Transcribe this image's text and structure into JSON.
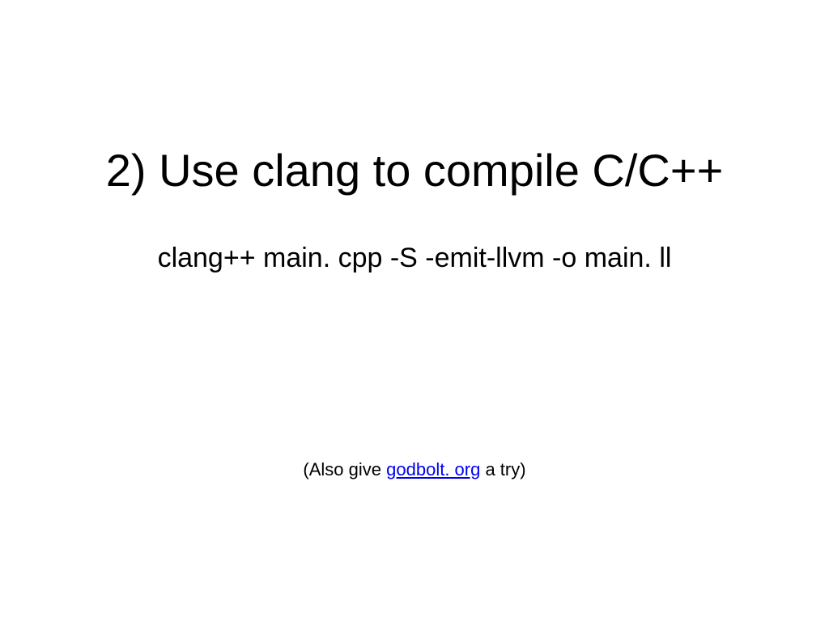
{
  "slide": {
    "title": "2) Use clang to compile C/C++",
    "command": "clang++ main. cpp -S -emit-llvm -o main. ll",
    "footnote_prefix": "(Also give ",
    "footnote_link": "godbolt. org",
    "footnote_suffix": " a try)"
  }
}
